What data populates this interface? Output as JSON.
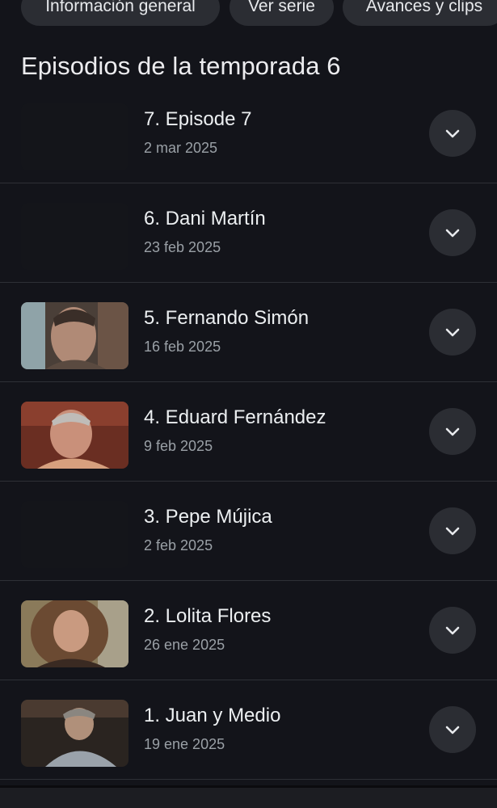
{
  "chips": [
    {
      "label": "Información general"
    },
    {
      "label": "Ver serie"
    },
    {
      "label": "Avances y clips"
    }
  ],
  "section": {
    "title": "Episodios de la temporada 6"
  },
  "episodes": [
    {
      "title": "7. Episode 7",
      "date": "2 mar 2025",
      "thumbnail": "none"
    },
    {
      "title": "6. Dani Martín",
      "date": "23 feb 2025",
      "thumbnail": "none"
    },
    {
      "title": "5. Fernando Simón",
      "date": "16 feb 2025",
      "thumbnail": "portrait"
    },
    {
      "title": "4. Eduard Fernández",
      "date": "9 feb 2025",
      "thumbnail": "portrait"
    },
    {
      "title": "3. Pepe Mújica",
      "date": "2 feb 2025",
      "thumbnail": "none"
    },
    {
      "title": "2. Lolita Flores",
      "date": "26 ene 2025",
      "thumbnail": "portrait"
    },
    {
      "title": "1. Juan y Medio",
      "date": "19 ene 2025",
      "thumbnail": "portrait"
    }
  ],
  "icons": {
    "expand": "chevron-down-icon"
  },
  "colors": {
    "background": "#13141a",
    "chip": "#2b2d33",
    "divider": "#2e3036",
    "text": "#eceff1",
    "subtext": "#9aa0a6"
  }
}
